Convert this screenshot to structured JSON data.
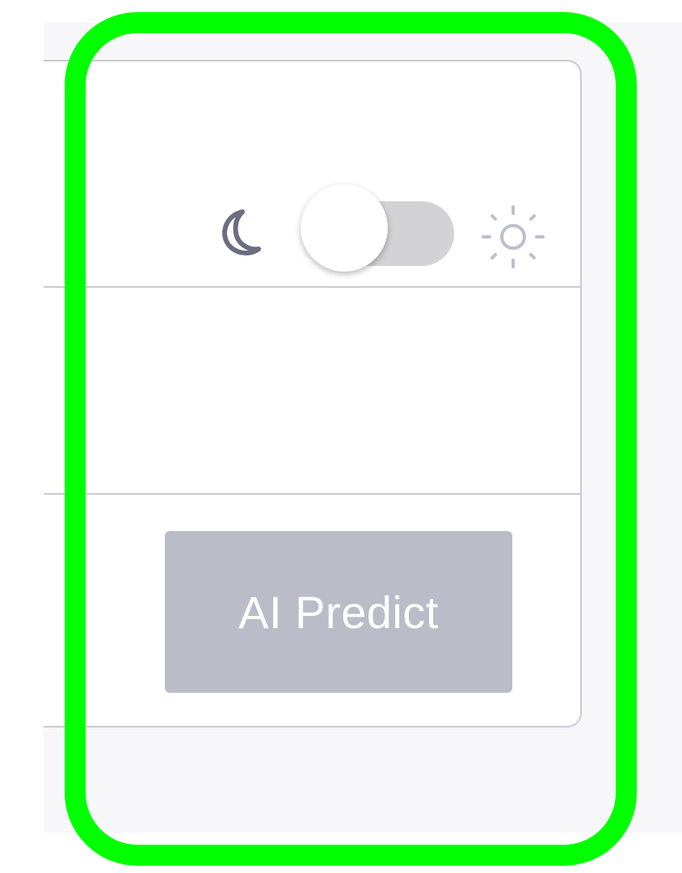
{
  "theme": {
    "left_icon": "moon-icon",
    "right_icon": "sun-icon",
    "switch_state": "dark"
  },
  "actions": {
    "ai_predict_label": "AI Predict",
    "ai_predict_enabled": false
  },
  "colors": {
    "highlight": "#00ff00",
    "button_disabled": "#babdc7",
    "track": "#d3d3d6",
    "moon": "#6b6e80",
    "sun": "#bdbfca"
  }
}
